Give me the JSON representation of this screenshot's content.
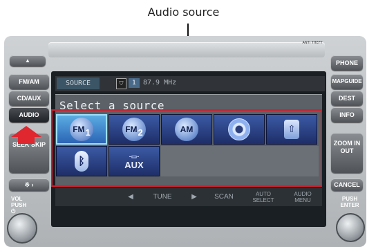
{
  "callout": {
    "label": "Audio source"
  },
  "head_unit": {
    "anti_theft": "ANTI THEFT",
    "left_buttons": {
      "eject": "▲",
      "fm_am": "FM/AM",
      "cd_aux": "CD/AUX",
      "audio": "AUDIO",
      "seek_skip": "SEEK SKIP",
      "preset": "※ ›",
      "vol": "VOL PUSH ⏻"
    },
    "right_buttons": {
      "phone": "PHONE",
      "map_guide": "MAPGUIDE",
      "dest": "DEST",
      "info": "INFO",
      "zoom": "ZOOM IN OUT",
      "cancel": "CANCEL",
      "enter": "PUSH ENTER"
    }
  },
  "screen": {
    "source_tab": "SOURCE",
    "preset_number": "1",
    "frequency": "87.9 MHz",
    "popup_title": "Select a source",
    "sources": [
      {
        "name": "fm1",
        "main": "FM",
        "sub": "1",
        "selected": true
      },
      {
        "name": "fm2",
        "main": "FM",
        "sub": "2",
        "selected": false
      },
      {
        "name": "am",
        "main": "AM",
        "sub": "",
        "selected": false
      },
      {
        "name": "disc",
        "main": "",
        "sub": "",
        "selected": false
      },
      {
        "name": "usb",
        "main": "⇧",
        "sub": "",
        "selected": false
      },
      {
        "name": "bluetooth",
        "main": "ᛒ",
        "sub": "",
        "selected": false
      },
      {
        "name": "aux",
        "main": "AUX",
        "sub": "",
        "selected": false
      }
    ],
    "softkeys": {
      "prev": "◀",
      "tune": "TUNE",
      "next": "▶",
      "scan": "SCAN",
      "auto_select": "AUTO SELECT",
      "audio_menu": "AUDIO MENU"
    }
  },
  "colors": {
    "highlight": "#d21e2e",
    "selected_cell": "#5caee4",
    "cell": "#2a3f86"
  }
}
